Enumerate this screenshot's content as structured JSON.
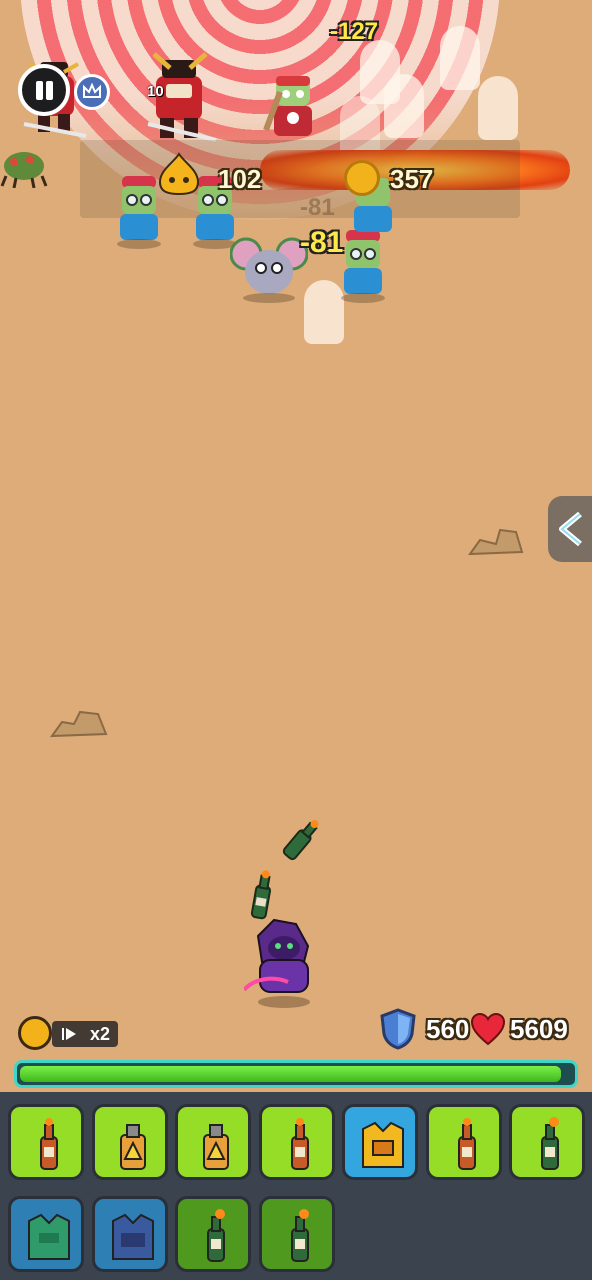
{
  "hud": {
    "wave": "10",
    "slime_count": "102",
    "coin_count": "357"
  },
  "damage_numbers": [
    {
      "text": "-127",
      "style": "bright"
    },
    {
      "text": "-81",
      "style": "bright"
    },
    {
      "text": "-81",
      "style": "faded"
    }
  ],
  "controls": {
    "speed_label": "x2",
    "pause_icon": "pause-icon",
    "side_toggle_icon": "chevron-left-icon"
  },
  "stats": {
    "shield_value": "560",
    "health_value": "5609",
    "health_fraction": 0.98
  },
  "inventory": {
    "slots": [
      {
        "name": "molotov-bottle-icon",
        "color": "lime"
      },
      {
        "name": "hazard-canister-icon",
        "color": "lime"
      },
      {
        "name": "hazard-canister-icon",
        "color": "lime"
      },
      {
        "name": "molotov-bottle-icon",
        "color": "lime"
      },
      {
        "name": "gold-armor-vest-icon",
        "color": "blue"
      },
      {
        "name": "molotov-bottle-icon",
        "color": "lime"
      },
      {
        "name": "green-fire-bottle-icon",
        "color": "lime"
      },
      {
        "name": "green-armor-vest-icon",
        "color": "darkblue"
      },
      {
        "name": "blue-armor-vest-icon",
        "color": "darkblue"
      },
      {
        "name": "green-fire-bottle-icon",
        "color": "darkgreen"
      },
      {
        "name": "green-fire-bottle-icon",
        "color": "darkgreen"
      }
    ]
  },
  "colors": {
    "sand": "#ddac79",
    "hp_green": "#5ad42e",
    "hp_border": "#3fd6c8",
    "inventory_bg": "#3b434f"
  }
}
